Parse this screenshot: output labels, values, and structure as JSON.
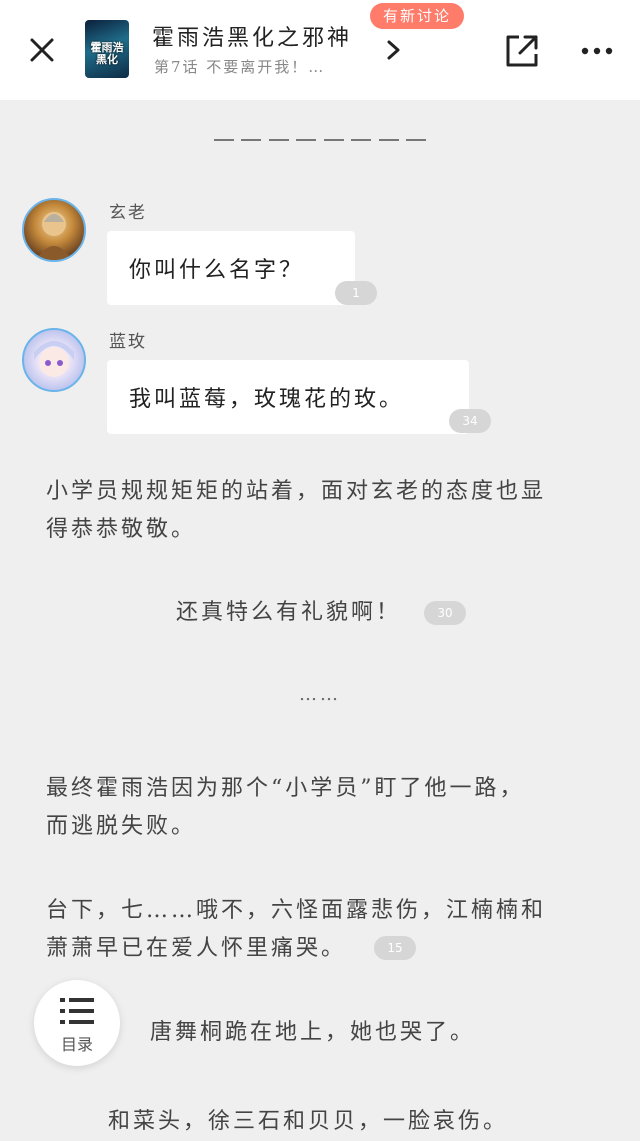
{
  "header": {
    "comic_title": "霍雨浩黑化之邪神",
    "episode_subtitle": "第7话 不要离开我！…",
    "new_discussion_badge": "有新讨论",
    "cover_text": "霍雨浩黑化"
  },
  "content": {
    "lines": [
      {
        "speaker": "玄老",
        "text": "你叫什么名字？",
        "count": "1"
      },
      {
        "speaker": "蓝玫",
        "text": "我叫蓝莓，玫瑰花的玫。",
        "count": "34"
      }
    ],
    "para1": [
      "小学员规规矩矩的站着，面对玄老的态度也显",
      "得恭恭敬敬。"
    ],
    "quote": {
      "text": "还真特么有礼貌啊！",
      "count": "30"
    },
    "ellipsis": "……",
    "para2": [
      "最终霍雨浩因为那个“小学员”盯了他一路，",
      "而逃脱失败。"
    ],
    "para3": {
      "lines": [
        "台下，七……哦不，六怪面露悲伤，江楠楠和",
        "萧萧早已在爱人怀里痛哭。"
      ],
      "count": "15"
    },
    "para4": "唐舞桐跪在地上，她也哭了。",
    "para5": "和菜头，徐三石和贝贝，一脸哀伤。"
  },
  "toc": {
    "label": "目录"
  }
}
